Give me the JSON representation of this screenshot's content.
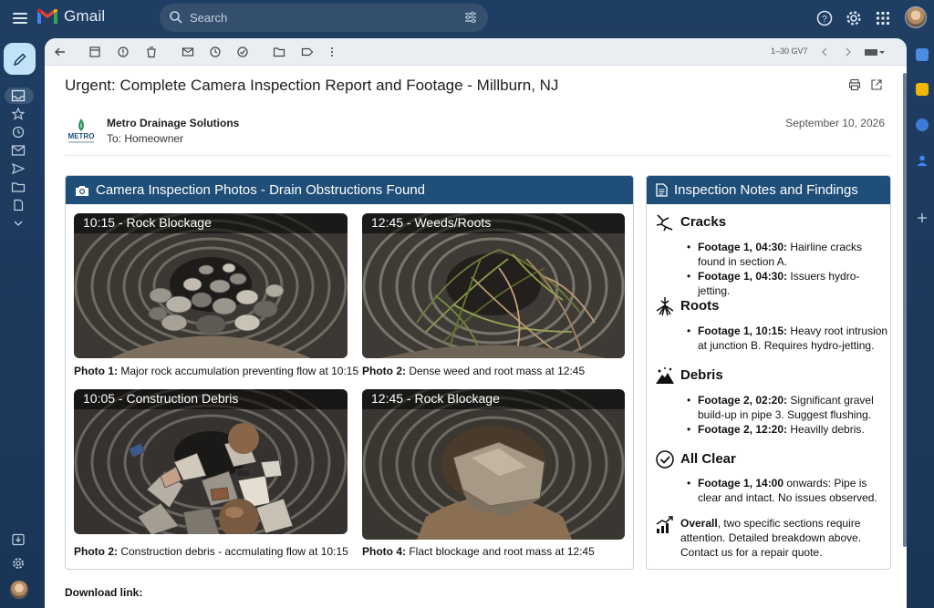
{
  "app": {
    "name": "Gmail",
    "search_placeholder": "Search"
  },
  "toolbar": {
    "count": "1–30 GV7"
  },
  "email": {
    "subject": "Urgent: Complete Camera Inspection Report and Footage - Millburn, NJ",
    "sender": "Metro Drainage Solutions",
    "sender_logo_text": "METRO",
    "to": "To: Homeowner",
    "date": "September 10, 2026",
    "download_label": "Download link:"
  },
  "photos_card": {
    "title": "Camera Inspection Photos - Drain Obstructions Found",
    "photos": [
      {
        "tag": "10:15 - Rock Blockage",
        "caption_bold": "Photo 1:",
        "caption": " Major rock accumulation preventing flow at 10:15"
      },
      {
        "tag": "12:45 - Weeds/Roots",
        "caption_bold": "Photo 2:",
        "caption": " Dense weed and root mass at 12:45"
      },
      {
        "tag": "10:05 - Construction Debris",
        "caption_bold": "Photo 2:",
        "caption": " Construction debris - accmulating flow at 10:15"
      },
      {
        "tag": "12:45 - Rock Blockage",
        "caption_bold": "Photo 4:",
        "caption": " Flact blockage and root mass at 12:45"
      }
    ]
  },
  "notes_card": {
    "title": "Inspection Notes and Findings",
    "sections": [
      {
        "title": "Cracks",
        "icon": "crack-icon",
        "bullets": [
          {
            "bold": "Footage 1, 04:30:",
            "text": " Hairline cracks found in section A."
          },
          {
            "bold": "Footage 1, 04:30:",
            "text": " Issuers hydro-jetting."
          }
        ]
      },
      {
        "title": "Roots",
        "icon": "roots-icon",
        "bullets": [
          {
            "bold": "Footage 1, 10:15:",
            "text": " Heavy root intrusion at junction B. Requires hydro-jetting."
          }
        ]
      },
      {
        "title": "Debris",
        "icon": "debris-icon",
        "bullets": [
          {
            "bold": "Footage 2, 02:20:",
            "text": " Significant gravel build-up in pipe 3. Suggest flushing."
          },
          {
            "bold": "Footage 2, 12:20:",
            "text": " Heavilly debris."
          }
        ]
      },
      {
        "title": "All Clear",
        "icon": "check-circle-icon",
        "bullets": [
          {
            "bold": "Footage 1, 14:00",
            "text": " onwards: Pipe is clear and intact. No issues observed."
          }
        ]
      }
    ],
    "overall_bold": "Overall",
    "overall_text": ", two specific sections require attention. Detailed breakdown above. Contact us for a repair quote."
  }
}
